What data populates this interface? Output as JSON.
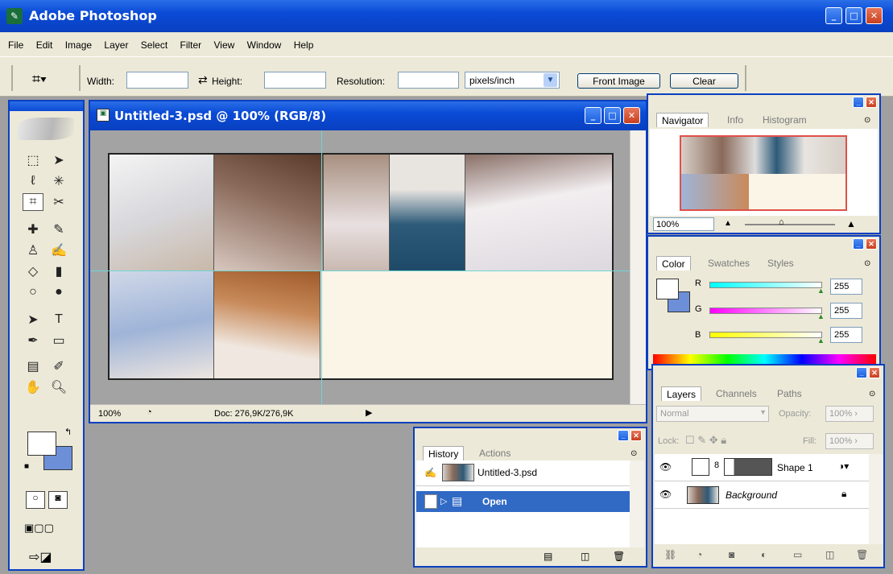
{
  "app": {
    "title": "Adobe Photoshop"
  },
  "menu": [
    "File",
    "Edit",
    "Image",
    "Layer",
    "Select",
    "Filter",
    "View",
    "Window",
    "Help"
  ],
  "options_bar": {
    "width_label": "Width:",
    "height_label": "Height:",
    "resolution_label": "Resolution:",
    "units_value": "pixels/inch",
    "front_image_label": "Front Image",
    "clear_label": "Clear"
  },
  "document": {
    "title": "Untitled-3.psd @ 100% (RGB/8)",
    "zoom": "100%",
    "doc_info": "Doc: 276,9K/276,9K"
  },
  "navigator": {
    "tabs": [
      "Navigator",
      "Info",
      "Histogram"
    ],
    "zoom": "100%"
  },
  "color_panel": {
    "tabs": [
      "Color",
      "Swatches",
      "Styles"
    ],
    "r_label": "R",
    "g_label": "G",
    "b_label": "B",
    "r_value": "255",
    "g_value": "255",
    "b_value": "255"
  },
  "history": {
    "tabs": [
      "History",
      "Actions"
    ],
    "snapshot": "Untitled-3.psd",
    "states": [
      "Open"
    ]
  },
  "layers": {
    "tabs": [
      "Layers",
      "Channels",
      "Paths"
    ],
    "blend_mode": "Normal",
    "opacity_label": "Opacity:",
    "opacity_value": "100%",
    "lock_label": "Lock:",
    "fill_label": "Fill:",
    "fill_value": "100%",
    "items": [
      {
        "name": "Shape 1"
      },
      {
        "name": "Background"
      }
    ]
  },
  "colors": {
    "accent": "#0a4bd6",
    "canvas_bg": "#fbf5e8",
    "workspace": "#a0a0a0",
    "background_swatch": "#6d8fd8"
  }
}
